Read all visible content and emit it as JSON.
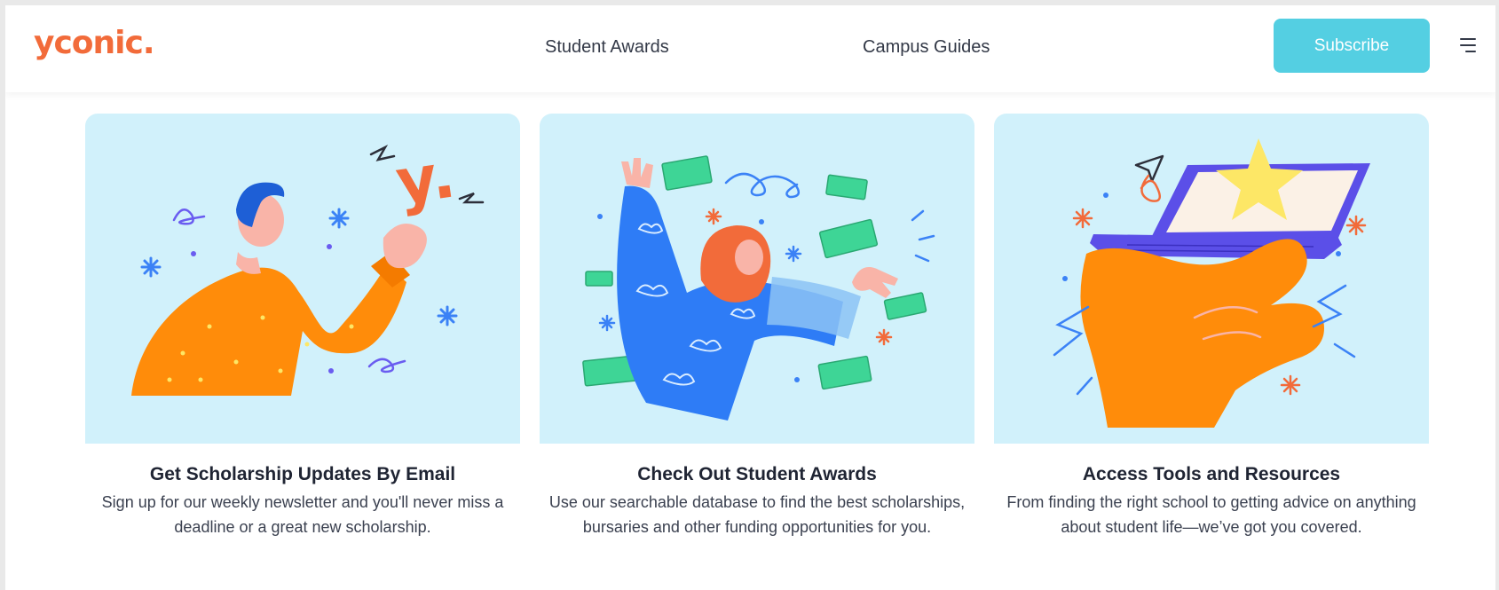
{
  "header": {
    "logo": "yconic.",
    "nav": [
      {
        "label": "Student Awards"
      },
      {
        "label": "Campus Guides"
      }
    ],
    "subscribe_label": "Subscribe",
    "menu_icon": "hamburger-menu-icon"
  },
  "cards": [
    {
      "illustration": "person-holding-y-logo",
      "title": "Get Scholarship Updates By Email",
      "text": "Sign up for our weekly newsletter and you'll never miss a deadline or a great new scholarship."
    },
    {
      "illustration": "person-catching-envelopes",
      "title": "Check Out Student Awards",
      "text": "Use our searchable database to find the best scholarships, bursaries and other funding opportunities for you."
    },
    {
      "illustration": "hand-holding-laptop-with-star",
      "title": "Access Tools and Resources",
      "text": "From finding the right school to getting advice on anything about student life—we’ve got you covered."
    }
  ],
  "illustration_text": {
    "logo_letter": "y."
  },
  "colors": {
    "brand": "#f26b3a",
    "subscribe_bg": "#54cfe2",
    "card_bg": "#d1f1fb",
    "orange": "#ff8c0a",
    "blue": "#3b82f6",
    "green": "#3ed596",
    "star": "#fde766",
    "laptop": "#5b4fe8"
  }
}
